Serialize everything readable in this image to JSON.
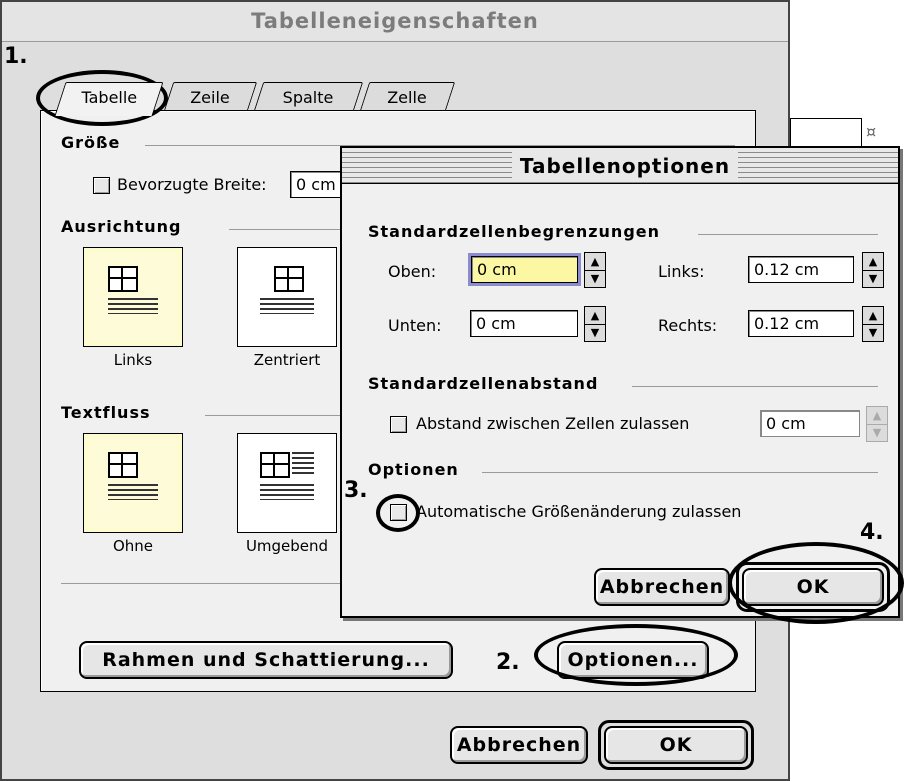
{
  "main_dialog": {
    "title": "Tabelleneigenschaften",
    "tabs": [
      {
        "label": "Tabelle"
      },
      {
        "label": "Zeile"
      },
      {
        "label": "Spalte"
      },
      {
        "label": "Zelle"
      }
    ],
    "groups": {
      "size": {
        "label": "Größe",
        "preferred_width_label": "Bevorzugte Breite:",
        "preferred_width_value": "0 cm"
      },
      "alignment": {
        "label": "Ausrichtung",
        "options": [
          {
            "label": "Links"
          },
          {
            "label": "Zentriert"
          }
        ]
      },
      "text_wrap": {
        "label": "Textfluss",
        "options": [
          {
            "label": "Ohne"
          },
          {
            "label": "Umgebend"
          }
        ]
      }
    },
    "borders_button": "Rahmen und Schattierung...",
    "options_button": "Optionen...",
    "cancel_button": "Abbrechen",
    "ok_button": "OK"
  },
  "options_dialog": {
    "title": "Tabellenoptionen",
    "margins": {
      "label": "Standardzellenbegrenzungen",
      "top_label": "Oben:",
      "top_value": "0 cm",
      "bottom_label": "Unten:",
      "bottom_value": "0 cm",
      "left_label": "Links:",
      "left_value": "0.12 cm",
      "right_label": "Rechts:",
      "right_value": "0.12 cm"
    },
    "spacing": {
      "label": "Standardzellenabstand",
      "allow_label": "Abstand zwischen Zellen zulassen",
      "value": "0 cm"
    },
    "options": {
      "label": "Optionen",
      "autoresize_label": "Automatische Größenänderung zulassen"
    },
    "cancel_button": "Abbrechen",
    "ok_button": "OK"
  },
  "markers": [
    "1.",
    "2.",
    "3.",
    "4."
  ],
  "colors": {
    "focus_field": "#fbf7a2",
    "focus_ring": "#8b8bd0",
    "selected_tile": "#fdfbd8"
  }
}
